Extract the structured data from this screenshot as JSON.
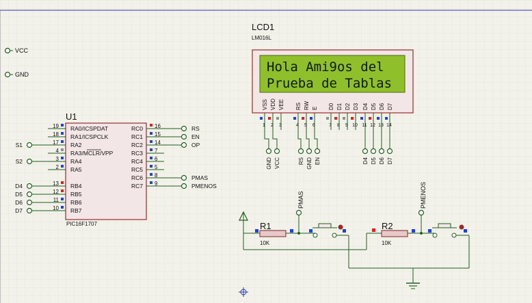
{
  "colors": {
    "background": "#f2f2ea",
    "grid": "#dcdcd2",
    "wire": "#1f5f1f",
    "component_fill": "#f3e6e6",
    "component_border": "#9a2a2a",
    "lcd_screen": "#8fbf2a",
    "pin_high": "#e02020",
    "pin_low": "#2040e0",
    "pin_float": "#909090"
  },
  "lcd": {
    "ref": "LCD1",
    "model": "LM016L",
    "line1": "Hola Ami9os del",
    "line2": "Prueba de Tablas",
    "pins": [
      "VSS",
      "VDD",
      "VEE",
      "RS",
      "RW",
      "E",
      "D0",
      "D1",
      "D2",
      "D3",
      "D4",
      "D5",
      "D6",
      "D7"
    ],
    "pin_numbers": [
      "1",
      "2",
      "3",
      "4",
      "5",
      "6",
      "7",
      "8",
      "9",
      "10",
      "11",
      "12",
      "13",
      "14"
    ]
  },
  "lcd_terminals": [
    "GND",
    "VCC",
    "RS",
    "GND",
    "EN",
    "D4",
    "D5",
    "D6",
    "D7"
  ],
  "power_terminals": [
    "VCC",
    "GND"
  ],
  "mcu": {
    "ref": "U1",
    "model": "PIC16F1707",
    "left_pins": [
      {
        "num": "19",
        "name": "RA0/ICSPDAT",
        "net": ""
      },
      {
        "num": "18",
        "name": "RA1/ICSPCLK",
        "net": ""
      },
      {
        "num": "17",
        "name": "RA2",
        "net": "S1"
      },
      {
        "num": "4",
        "name": "RA3/MCLR/VPP",
        "net": ""
      },
      {
        "num": "3",
        "name": "RA4",
        "net": "S2"
      },
      {
        "num": "2",
        "name": "RA5",
        "net": ""
      },
      {
        "num": "13",
        "name": "RB4",
        "net": "D4"
      },
      {
        "num": "12",
        "name": "RB5",
        "net": "D5"
      },
      {
        "num": "11",
        "name": "RB6",
        "net": "D6"
      },
      {
        "num": "10",
        "name": "RB7",
        "net": "D7"
      }
    ],
    "right_pins": [
      {
        "num": "16",
        "name": "RC0",
        "net": "RS"
      },
      {
        "num": "15",
        "name": "RC1",
        "net": "EN"
      },
      {
        "num": "14",
        "name": "RC2",
        "net": "OP"
      },
      {
        "num": "7",
        "name": "RC3",
        "net": ""
      },
      {
        "num": "6",
        "name": "RC4",
        "net": ""
      },
      {
        "num": "5",
        "name": "RC5",
        "net": ""
      },
      {
        "num": "8",
        "name": "RC6",
        "net": "PMAS"
      },
      {
        "num": "9",
        "name": "RC7",
        "net": "PMENOS"
      }
    ]
  },
  "resistors": [
    {
      "ref": "R1",
      "value": "10K",
      "net": "PMAS"
    },
    {
      "ref": "R2",
      "value": "10K",
      "net": "PMENOS"
    }
  ]
}
